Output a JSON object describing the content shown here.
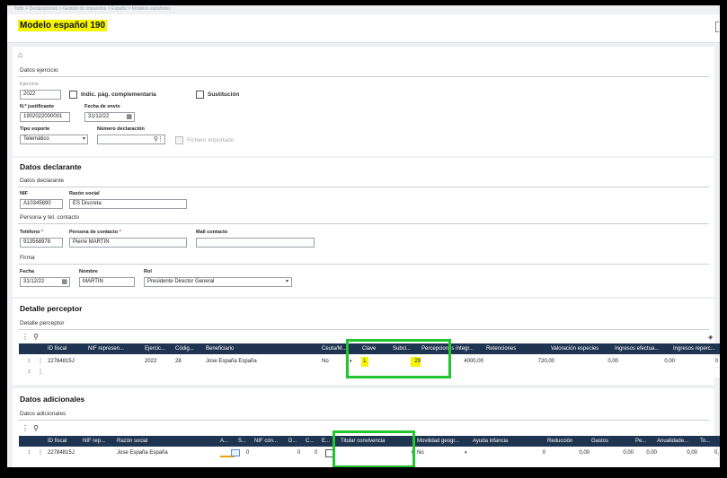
{
  "breadcrumb": [
    "Todo",
    "Declaraciones",
    "Gestión de impuestos",
    "España",
    "Modelos españoles"
  ],
  "breadcrumb_sep": ">",
  "page_title": "Modelo español 190",
  "datos_ejercicio": {
    "section_label": "Datos ejercicio",
    "ejercicio_label": "Ejercicio",
    "ejercicio_value": "2022",
    "indic_label": "Indic. pág. complementaria",
    "sustitucion_label": "Sustitución",
    "justificante_label": "N.º justificante",
    "justificante_value": "1902022000001",
    "fecha_envio_label": "Fecha de envío",
    "fecha_envio_value": "31/12/22",
    "tipo_soporte_label": "Tipo soporte",
    "tipo_soporte_value": "Telemático",
    "numero_declaracion_label": "Número declaración",
    "numero_declaracion_value": "",
    "fichero_label": "Fichero importado"
  },
  "datos_declarante": {
    "title": "Datos declarante",
    "sub": "Datos declarante",
    "nif_label": "NIF",
    "nif_value": "A10345890",
    "razon_label": "Razón social",
    "razon_value": "ES Discreta",
    "contacto_sub": "Persona y tel. contacto",
    "telefono_label": "Teléfono",
    "telefono_value": "913568978",
    "persona_label": "Persona de contacto",
    "persona_value": "Pierre MARTIN",
    "mail_label": "Mail contacto",
    "mail_value": "",
    "req_mark": "*",
    "firma_sub": "Firma",
    "fecha_label": "Fecha",
    "fecha_value": "31/12/22",
    "nombre_label": "Nombre",
    "nombre_value": "MARTIN",
    "rol_label": "Rol",
    "rol_value": "Presidente Director General"
  },
  "detalle_perceptor": {
    "title": "Detalle perceptor",
    "sub": "Detalle perceptor",
    "columns": [
      "ID fiscal",
      "NIF represen...",
      "Ejercic...",
      "Códig...",
      "Beneficiario",
      "Ceuta/M...",
      "Clave",
      "Subcl...",
      "Percepciones íntegr...",
      "Retenciones",
      "Valoración especies",
      "Ingresos efectua...",
      "Ingresos reperc..."
    ],
    "row1": {
      "num": "1",
      "id_fiscal": "22784815J",
      "nif_rep": "",
      "ejercicio": "2022",
      "codigo": "28",
      "beneficiario": "Jose España España",
      "ceuta": "No",
      "clave": "L",
      "subclave": "29",
      "percepciones": "4000,00",
      "retenciones": "720,00",
      "valoracion": "0,00",
      "ingresos_efect": "0,00",
      "ingresos_reperc": "0"
    },
    "row2_num": "2"
  },
  "datos_adicionales": {
    "title": "Datos adicionales",
    "sub": "Datos adicionales",
    "columns": [
      "ID fiscal",
      "NIF rep...",
      "Razón social",
      "A...",
      "S...",
      "NIF cón...",
      "D...",
      "C...",
      "E...",
      "Titular convivencia",
      "Movilidad geogr...",
      "Ayuda infancia",
      "Reducción",
      "Gastos",
      "Pe...",
      "Anualidade...",
      "To..."
    ],
    "row1": {
      "num": "1",
      "id_fiscal": "22784815J",
      "razon": "Jose España España",
      "s_val": "0",
      "d_val": "0",
      "c_val": "0",
      "titular": "0",
      "movilidad": "No",
      "ayuda": "0",
      "reduccion": "0,00",
      "gastos": "0,00",
      "pe": "0,00",
      "anualidades": "0,00",
      "to": "0,"
    }
  },
  "icons": {
    "home": "⌂",
    "kebab": "⋮",
    "search": "⚲",
    "calendar": "▦",
    "chevron": "▾",
    "stack": "◈"
  },
  "colors": {
    "header_bg": "#1f3450",
    "highlight": "#f5f500",
    "annotation_box": "#22c52e"
  }
}
